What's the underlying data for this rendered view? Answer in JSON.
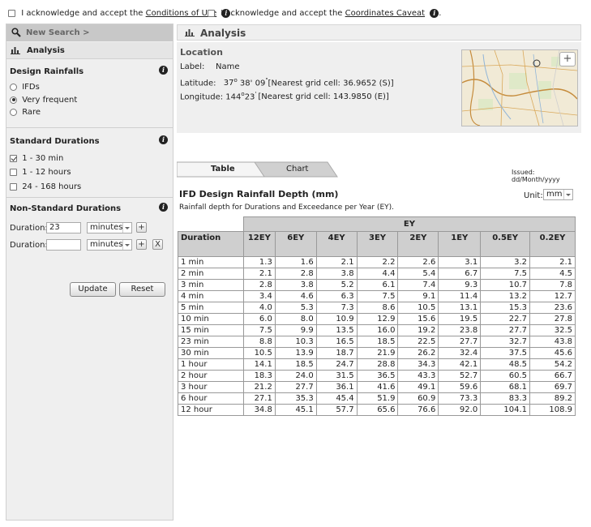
{
  "consent": {
    "prefix_1": "I acknowledge and accept the ",
    "link_1": "Conditions of Use",
    "prefix_2": "I acknowledge and accept the ",
    "link_2": "Coordinates Caveat"
  },
  "sidebar": {
    "new_search": "New Search >",
    "analysis": "Analysis",
    "design_rainfalls": {
      "title": "Design Rainfalls",
      "options": [
        "IFDs",
        "Very frequent",
        "Rare"
      ],
      "selected_index": 1
    },
    "standard_durations": {
      "title": "Standard Durations",
      "options": [
        "1 - 30 min",
        "1 - 12 hours",
        "24 - 168 hours"
      ],
      "checked": [
        true,
        false,
        false
      ]
    },
    "non_standard": {
      "title": "Non-Standard Durations",
      "rows": [
        {
          "label": "Duration:",
          "value": "23",
          "unit": "minutes"
        },
        {
          "label": "Duration:",
          "value": "",
          "unit": "minutes"
        }
      ],
      "add_label": "+",
      "remove_label": "X"
    },
    "update_label": "Update",
    "reset_label": "Reset"
  },
  "main": {
    "title": "Analysis",
    "location": {
      "title": "Location",
      "label_key": "Label:",
      "label_value": "Name",
      "lat_key": "Latitude:",
      "lat_deg": "37",
      "lat_deg_sup": "o",
      "lat_rest": " 38' 09",
      "lat_sec_sup": "\"",
      "lat_cell": "[Nearest grid cell: 36.9652 (S)]",
      "lon_key": "Longitude:",
      "lon_deg": "144",
      "lon_deg_sup": "o",
      "lon_rest": "23",
      "lon_min_sup": "'",
      "lon_cell": "[Nearest grid cell: 143.9850 (E)]",
      "map_zoom_label": "+"
    },
    "tabs": [
      {
        "label": "Table",
        "active": true
      },
      {
        "label": "Chart",
        "active": false
      }
    ],
    "issued": "Issued: dd/Month/yyyy",
    "table_title": "IFD Design Rainfall Depth (mm)",
    "table_subtitle": "Rainfall depth for Durations and Exceedance per Year (EY).",
    "unit_label": "Unit:",
    "unit_value": "mm",
    "group_header": "EY",
    "duration_header": "Duration",
    "columns": [
      "12EY",
      "6EY",
      "4EY",
      "3EY",
      "2EY",
      "1EY",
      "0.5EY",
      "0.2EY"
    ],
    "rows": [
      {
        "duration": "1 min",
        "values": [
          "1.3",
          "1.6",
          "2.1",
          "2.2",
          "2.6",
          "3.1",
          "3.2",
          "2.1"
        ]
      },
      {
        "duration": "2 min",
        "values": [
          "2.1",
          "2.8",
          "3.8",
          "4.4",
          "5.4",
          "6.7",
          "7.5",
          "4.5"
        ]
      },
      {
        "duration": "3 min",
        "values": [
          "2.8",
          "3.8",
          "5.2",
          "6.1",
          "7.4",
          "9.3",
          "10.7",
          "7.8"
        ]
      },
      {
        "duration": "4 min",
        "values": [
          "3.4",
          "4.6",
          "6.3",
          "7.5",
          "9.1",
          "11.4",
          "13.2",
          "12.7"
        ]
      },
      {
        "duration": "5 min",
        "values": [
          "4.0",
          "5.3",
          "7.3",
          "8.6",
          "10.5",
          "13.1",
          "15.3",
          "23.6"
        ]
      },
      {
        "duration": "10 min",
        "values": [
          "6.0",
          "8.0",
          "10.9",
          "12.9",
          "15.6",
          "19.5",
          "22.7",
          "27.8"
        ]
      },
      {
        "duration": "15 min",
        "values": [
          "7.5",
          "9.9",
          "13.5",
          "16.0",
          "19.2",
          "23.8",
          "27.7",
          "32.5"
        ]
      },
      {
        "duration": "23 min",
        "values": [
          "8.8",
          "10.3",
          "16.5",
          "18.5",
          "22.5",
          "27.7",
          "32.7",
          "43.8"
        ]
      },
      {
        "duration": "30 min",
        "values": [
          "10.5",
          "13.9",
          "18.7",
          "21.9",
          "26.2",
          "32.4",
          "37.5",
          "45.6"
        ]
      },
      {
        "duration": "1 hour",
        "values": [
          "14.1",
          "18.5",
          "24.7",
          "28.8",
          "34.3",
          "42.1",
          "48.5",
          "54.2"
        ]
      },
      {
        "duration": "2 hour",
        "values": [
          "18.3",
          "24.0",
          "31.5",
          "36.5",
          "43.3",
          "52.7",
          "60.5",
          "66.7"
        ]
      },
      {
        "duration": "3 hour",
        "values": [
          "21.2",
          "27.7",
          "36.1",
          "41.6",
          "49.1",
          "59.6",
          "68.1",
          "69.7"
        ]
      },
      {
        "duration": "6 hour",
        "values": [
          "27.1",
          "35.3",
          "45.4",
          "51.9",
          "60.9",
          "73.3",
          "83.3",
          "89.2"
        ]
      },
      {
        "duration": "12 hour",
        "values": [
          "34.8",
          "45.1",
          "57.7",
          "65.6",
          "76.6",
          "92.0",
          "104.1",
          "108.9"
        ]
      }
    ]
  }
}
